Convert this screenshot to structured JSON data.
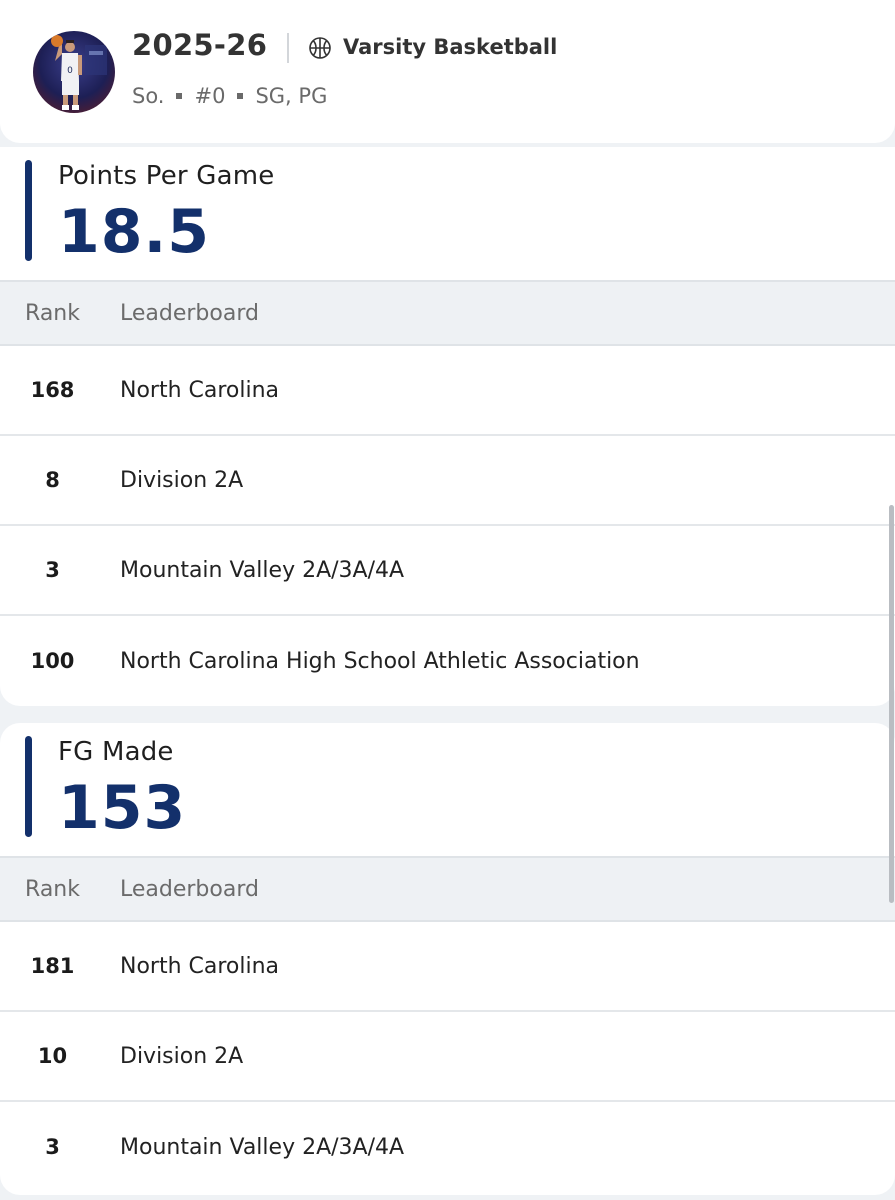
{
  "profile": {
    "season": "2025-26",
    "sport": "Varsity Basketball",
    "class_year": "So.",
    "jersey": "#0",
    "positions": "SG, PG"
  },
  "stats": [
    {
      "title": "Points Per Game",
      "value": "18.5",
      "headers": {
        "rank": "Rank",
        "board": "Leaderboard"
      },
      "rows": [
        {
          "rank": "168",
          "board": "North Carolina"
        },
        {
          "rank": "8",
          "board": "Division 2A"
        },
        {
          "rank": "3",
          "board": "Mountain Valley 2A/3A/4A"
        },
        {
          "rank": "100",
          "board": "North Carolina High School Athletic Association"
        }
      ]
    },
    {
      "title": "FG Made",
      "value": "153",
      "headers": {
        "rank": "Rank",
        "board": "Leaderboard"
      },
      "rows": [
        {
          "rank": "181",
          "board": "North Carolina"
        },
        {
          "rank": "10",
          "board": "Division 2A"
        },
        {
          "rank": "3",
          "board": "Mountain Valley 2A/3A/4A"
        }
      ]
    }
  ],
  "colors": {
    "accent": "#13306b",
    "header_bg": "#eef1f4",
    "page_bg": "#eff2f5"
  }
}
